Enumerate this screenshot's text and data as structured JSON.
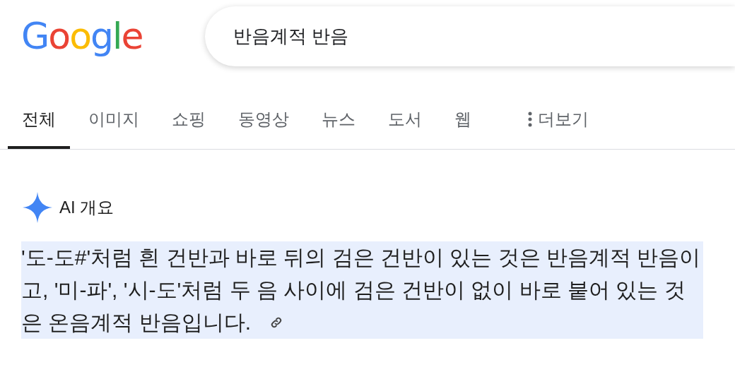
{
  "logo": "Google",
  "search": {
    "value": "반음계적 반음"
  },
  "tabs": [
    {
      "label": "전체",
      "selected": true
    },
    {
      "label": "이미지",
      "selected": false
    },
    {
      "label": "쇼핑",
      "selected": false
    },
    {
      "label": "동영상",
      "selected": false
    },
    {
      "label": "뉴스",
      "selected": false
    },
    {
      "label": "도서",
      "selected": false
    },
    {
      "label": "웹",
      "selected": false
    }
  ],
  "more_menu": "더보기",
  "ai_overview": {
    "title": "AI 개요",
    "text": "'도-도#'처럼 흰 건반과 바로 뒤의 검은 건반이 있는 것은 반음계적 반음이고, '미-파', '시-도'처럼 두 음 사이에 검은 건반이 없이 바로 붙어 있는 것은 온음계적 반음입니다."
  }
}
